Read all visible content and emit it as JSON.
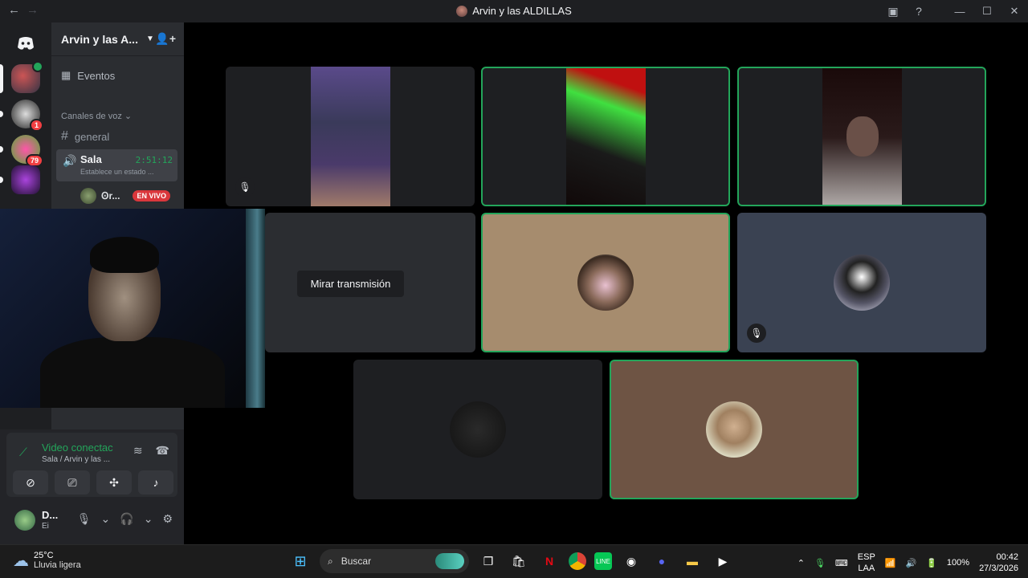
{
  "window": {
    "title": "Arvin y las ALDILLAS"
  },
  "server": {
    "name": "Arvin y las A...",
    "events_label": "Eventos",
    "voice_category": "Canales de voz",
    "channels": [
      {
        "name": "general"
      },
      {
        "name": "Sala",
        "duration": "2:51:12",
        "status": "Establece un estado ..."
      }
    ],
    "member": {
      "name": "Ꙩr...",
      "live_badge": "EN VIVO"
    }
  },
  "guild_badges": [
    "1",
    "79"
  ],
  "stage": {
    "watch_label": "Mirar transmisión"
  },
  "voice": {
    "connected": "Video conectac",
    "location": "Sala / Arvin y las ..."
  },
  "user": {
    "name": "D...",
    "status": "Ei"
  },
  "taskbar": {
    "weather_temp": "25°C",
    "weather_desc": "Lluvia ligera",
    "search_label": "Buscar",
    "lang_top": "ESP",
    "lang_bottom": "LAA",
    "battery": "100%",
    "time": "00:42",
    "date": "27/3/2026"
  }
}
